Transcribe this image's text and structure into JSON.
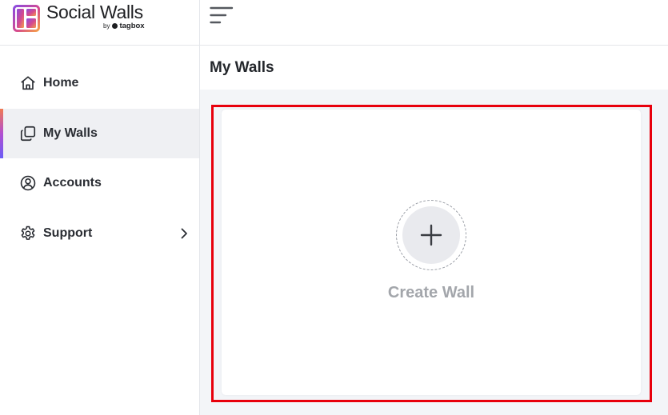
{
  "brand": {
    "title": "Social Walls",
    "by": "by",
    "company": "tagbox"
  },
  "sidebar": {
    "items": [
      {
        "label": "Home",
        "icon": "home-icon",
        "active": false
      },
      {
        "label": "My Walls",
        "icon": "walls-icon",
        "active": true
      },
      {
        "label": "Accounts",
        "icon": "account-icon",
        "active": false
      },
      {
        "label": "Support",
        "icon": "gear-icon",
        "active": false,
        "has_submenu": true
      }
    ]
  },
  "main": {
    "title": "My Walls",
    "create_card": {
      "label": "Create Wall",
      "icon": "plus-icon"
    }
  },
  "colors": {
    "highlight_border": "#e8000c",
    "active_nav_bg": "#eff0f3",
    "accent_gradient": [
      "#f07a52",
      "#b24fd0",
      "#6a5cf6"
    ]
  }
}
